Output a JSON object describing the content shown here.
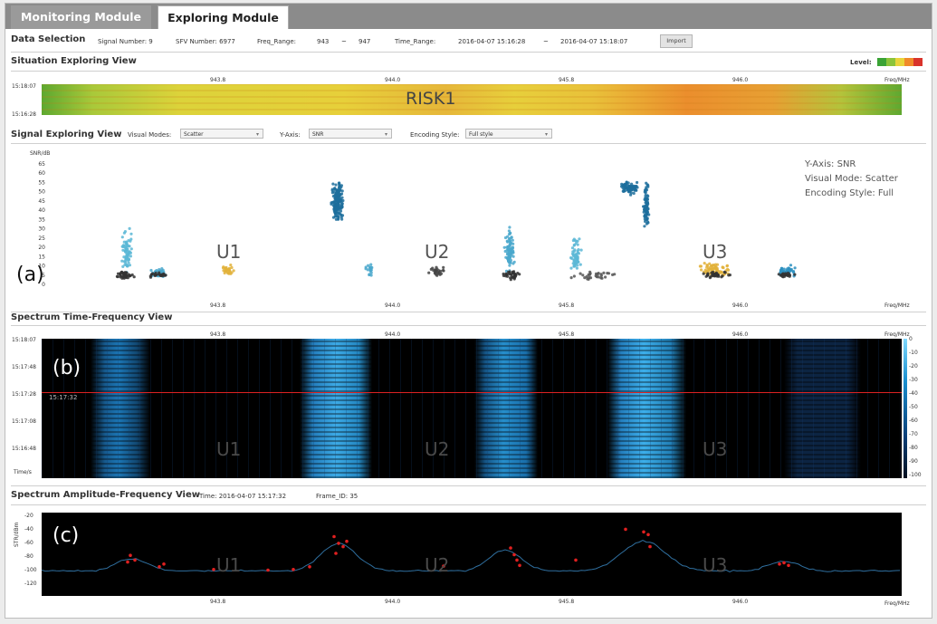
{
  "tabs": [
    {
      "label": "Monitoring Module"
    },
    {
      "label": "Exploring Module"
    }
  ],
  "data_selection": {
    "title": "Data Selection",
    "signal_number": "Signal Number: 9",
    "sfv_number": "SFV Number: 6977",
    "freq_range_label": "Freq_Range:",
    "freq_from": "943",
    "freq_sep": "~",
    "freq_to": "947",
    "time_range_label": "Time_Range:",
    "time_from": "2016-04-07 15:16:28",
    "time_sep": "~",
    "time_to": "2016-04-07 15:18:07",
    "import_label": "Import"
  },
  "situation": {
    "title": "Situation Exploring View",
    "level_label": "Level:",
    "level_colors": [
      "#3aa335",
      "#8cc43a",
      "#e9d43b",
      "#f08a2a",
      "#d9332b"
    ],
    "freq_ticks": [
      "943.8",
      "944.0",
      "945.8",
      "946.0"
    ],
    "freq_unit": "Freq/MHz",
    "time_top": "15:18:07",
    "time_bottom": "15:16:28",
    "risk_label": "RISK1"
  },
  "signal_explore": {
    "title": "Signal Exploring View",
    "visual_modes_label": "Visual Modes:",
    "visual_modes_value": "Scatter",
    "y_axis_label": "Y-Axis:",
    "y_axis_value": "SNR",
    "encoding_label": "Encoding Style:",
    "encoding_value": "Full style",
    "y_unit": "SNR/dB",
    "y_ticks": [
      "65",
      "60",
      "55",
      "50",
      "45",
      "40",
      "35",
      "30",
      "25",
      "20",
      "15",
      "10",
      "5",
      "0"
    ],
    "freq_ticks": [
      "943.8",
      "944.0",
      "945.8",
      "946.0"
    ],
    "freq_unit": "Freq/MHz",
    "info_lines": [
      "Y-Axis: SNR",
      "Visual Mode: Scatter",
      "Encoding Style: Full"
    ],
    "panel_label": "(a)",
    "users": [
      "U1",
      "U2",
      "U3"
    ]
  },
  "spectrum_tf": {
    "title": "Spectrum Time-Frequency View",
    "time_ticks": [
      "15:18:07",
      "15:17:48",
      "15:17:28",
      "15:17:08",
      "15:16:48"
    ],
    "time_unit": "Time/s",
    "freq_ticks": [
      "943.8",
      "944.0",
      "945.8",
      "946.0"
    ],
    "freq_unit": "Freq/MHz",
    "cursor_time": "15:17:32",
    "colorbar_ticks": [
      "0",
      "-10",
      "-20",
      "-30",
      "-40",
      "-50",
      "-60",
      "-70",
      "-80",
      "-90",
      "-100"
    ],
    "panel_label": "(b)",
    "users": [
      "U1",
      "U2",
      "U3"
    ]
  },
  "spectrum_af": {
    "title": "Spectrum Amplitude-Frequency View",
    "time": "Time: 2016-04-07 15:17:32",
    "frame": "Frame_ID: 35",
    "y_unit": "STR/dBm",
    "y_ticks": [
      "-20",
      "-40",
      "-60",
      "-80",
      "-100",
      "-120"
    ],
    "freq_ticks": [
      "943.8",
      "944.0",
      "945.8",
      "946.0"
    ],
    "freq_unit": "Freq/MHz",
    "panel_label": "(c)",
    "users": [
      "U1",
      "U2",
      "U3"
    ]
  }
}
